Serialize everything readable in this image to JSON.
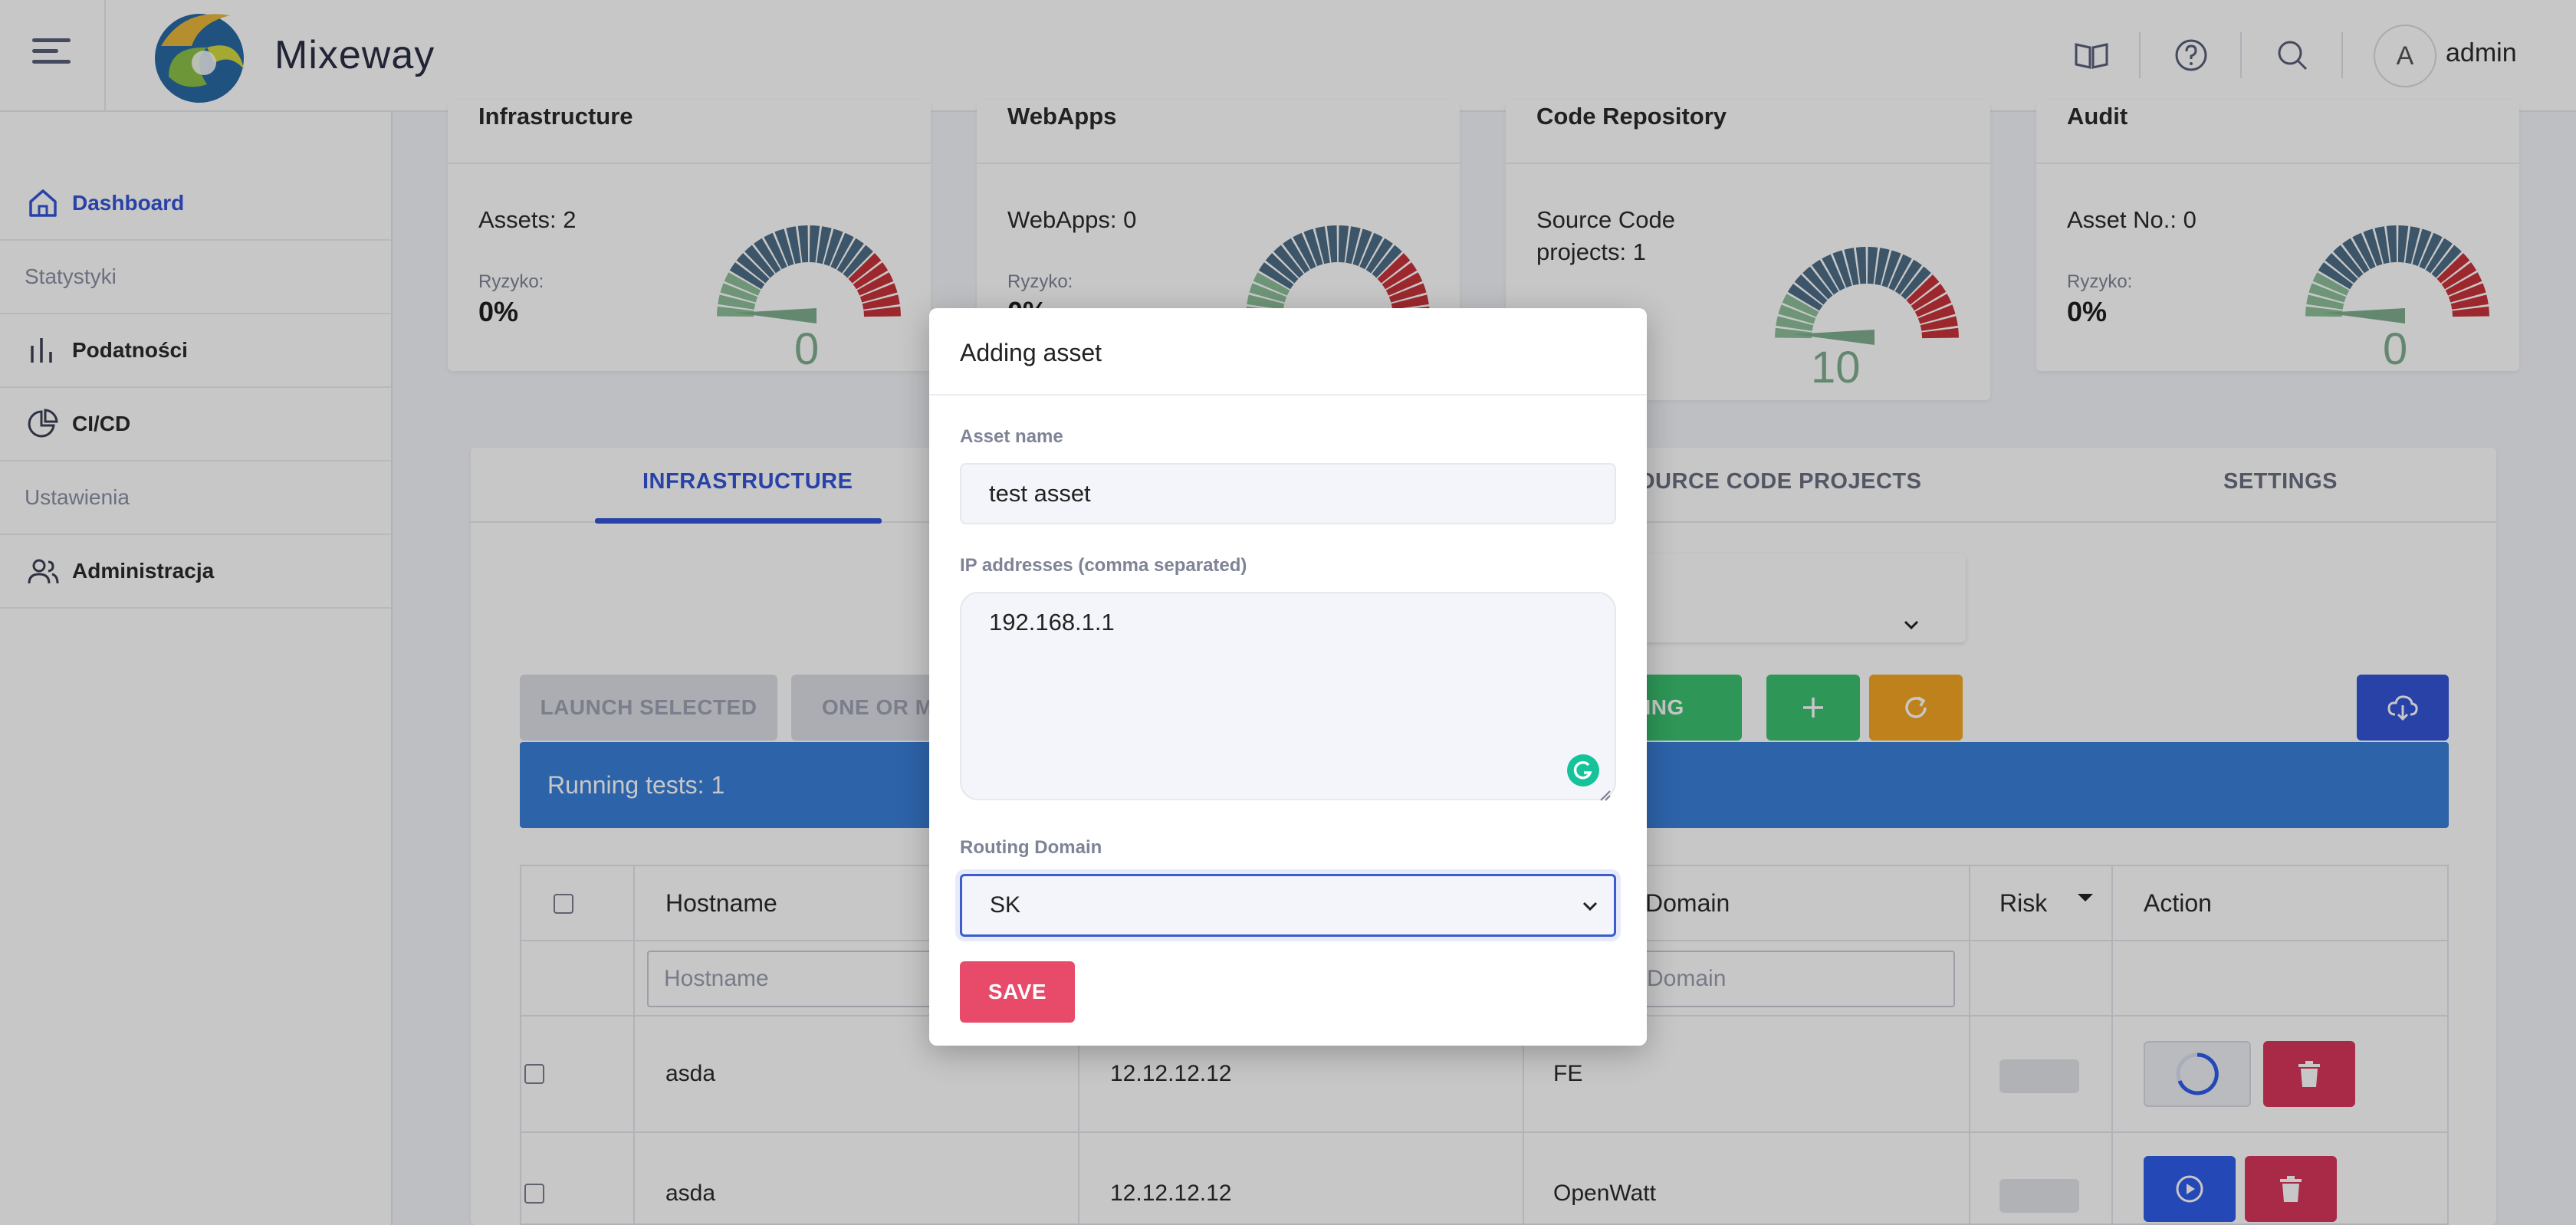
{
  "header": {
    "brand": "Mixeway",
    "avatar_initial": "A",
    "username": "admin",
    "icons": [
      "menu-icon",
      "book-icon",
      "help-icon",
      "search-icon"
    ]
  },
  "sidebar": {
    "items": [
      {
        "label": "Dashboard",
        "icon": "home-icon",
        "active": true
      },
      {
        "section": "Statystyki"
      },
      {
        "label": "Podatności",
        "icon": "bar-chart-icon"
      },
      {
        "label": "CI/CD",
        "icon": "pie-chart-icon"
      },
      {
        "section": "Ustawienia"
      },
      {
        "label": "Administracja",
        "icon": "users-icon"
      }
    ]
  },
  "cards": [
    {
      "title": "Infrastructure",
      "stat": "Assets: 2",
      "risk_label": "Ryzyko:",
      "risk_value": "0%",
      "gauge_value": "0"
    },
    {
      "title": "WebApps",
      "stat": "WebApps: 0",
      "risk_label": "Ryzyko:",
      "risk_value": "0%",
      "gauge_value": "0"
    },
    {
      "title": "Code Repository",
      "stat_line1": "Source Code",
      "stat_line2": "projects: 1",
      "gauge_value": "10"
    },
    {
      "title": "Audit",
      "stat": "Asset No.: 0",
      "risk_label": "Ryzyko:",
      "risk_value": "0%",
      "gauge_value": "0"
    }
  ],
  "tabs": [
    "INFRASTRUCTURE",
    "OURCE CODE PROJECTS",
    "SETTINGS"
  ],
  "toolbar": {
    "launch_selected": "LAUNCH SELECTED",
    "one_or_more": "ONE OR M",
    "running": "NNING",
    "add_icon": "plus-icon",
    "refresh_icon": "refresh-icon",
    "cloud_icon": "cloud-download-icon"
  },
  "banner": {
    "text": "Running tests: 1"
  },
  "table": {
    "headers": [
      "Hostname",
      "Domain",
      "Risk",
      "Action"
    ],
    "filters": {
      "hostname_placeholder": "Hostname",
      "domain_placeholder": "Domain"
    },
    "rows": [
      {
        "hostname": "asda",
        "ip": "12.12.12.12",
        "domain": "FE",
        "state": "running"
      },
      {
        "hostname": "asda",
        "ip": "12.12.12.12",
        "domain": "OpenWatt",
        "state": "idle"
      }
    ]
  },
  "modal": {
    "title": "Adding asset",
    "asset_name_label": "Asset name",
    "asset_name_value": "test asset",
    "ip_label": "IP addresses (comma separated)",
    "ip_value": "192.168.1.1",
    "routing_label": "Routing Domain",
    "routing_value": "SK",
    "save_label": "SAVE"
  },
  "colors": {
    "accent": "#3455d6",
    "success": "#3cc070",
    "warning": "#f4a623",
    "danger": "#e84a6a",
    "banner": "#3a7fd9"
  }
}
